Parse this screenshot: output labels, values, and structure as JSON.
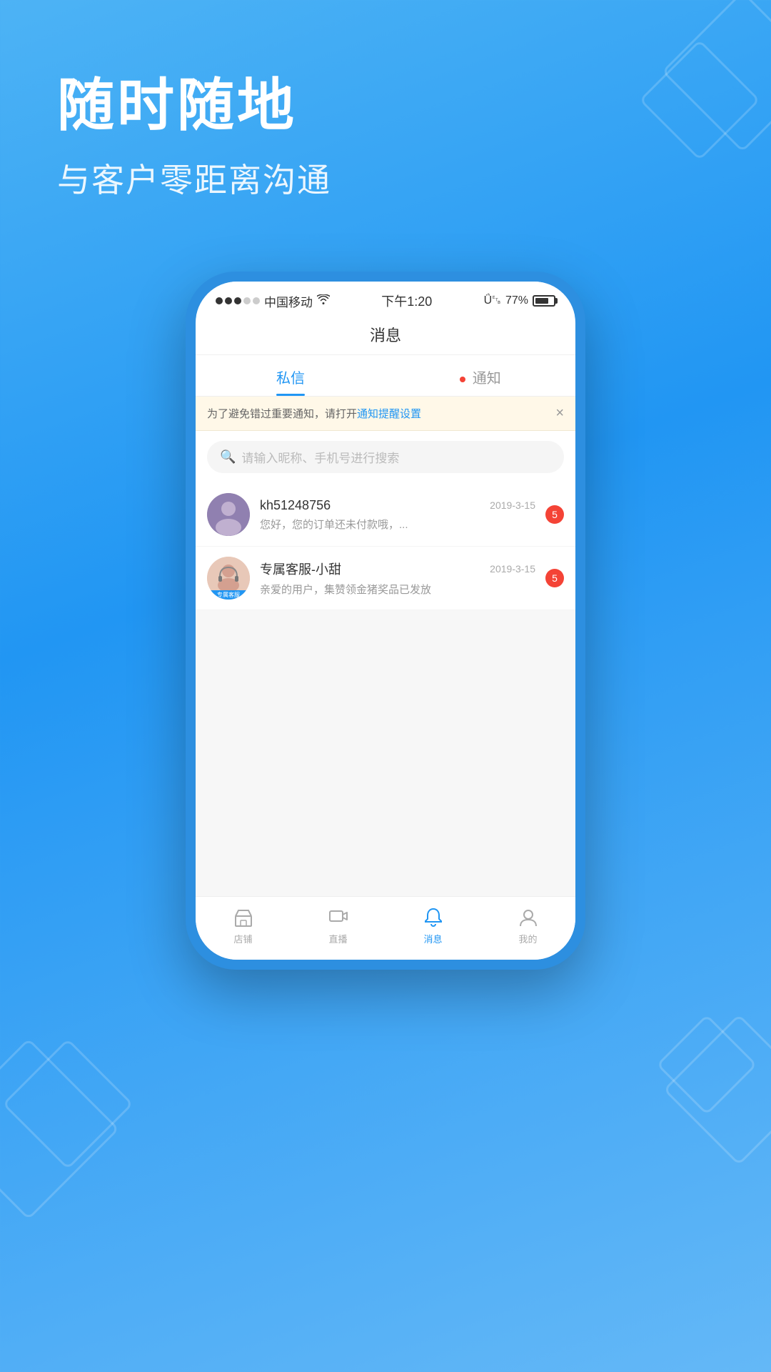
{
  "background": {
    "gradient_start": "#4db3f5",
    "gradient_end": "#2196f3"
  },
  "hero": {
    "title": "随时随地",
    "subtitle": "与客户零距离沟通"
  },
  "phone": {
    "status_bar": {
      "carrier": "中国移动",
      "time": "下午1:20",
      "bluetooth": "\\u00a9",
      "battery_pct": "77%"
    },
    "nav_title": "消息",
    "tabs": [
      {
        "label": "私信",
        "active": true,
        "has_dot": false
      },
      {
        "label": "通知",
        "active": false,
        "has_dot": true
      }
    ],
    "banner": {
      "text_before": "为了避免错过重要通知，请打开",
      "link_text": "通知提醒设置",
      "text_after": ""
    },
    "search": {
      "placeholder": "请输入昵称、手机号进行搜索"
    },
    "messages": [
      {
        "id": 1,
        "name": "kh51248756",
        "date": "2019-3-15",
        "preview": "您好，您的订单还未付款哦，...",
        "badge": 5,
        "avatar_type": "user"
      },
      {
        "id": 2,
        "name": "专属客服-小甜",
        "date": "2019-3-15",
        "preview": "亲爱的用户，集赞领金猪奖品已发放",
        "badge": 5,
        "avatar_type": "service",
        "service_label": "专属客服"
      }
    ],
    "bottom_tabs": [
      {
        "label": "店铺",
        "active": false,
        "icon": "store"
      },
      {
        "label": "直播",
        "active": false,
        "icon": "live"
      },
      {
        "label": "消息",
        "active": true,
        "icon": "message"
      },
      {
        "label": "我的",
        "active": false,
        "icon": "profile"
      }
    ]
  }
}
